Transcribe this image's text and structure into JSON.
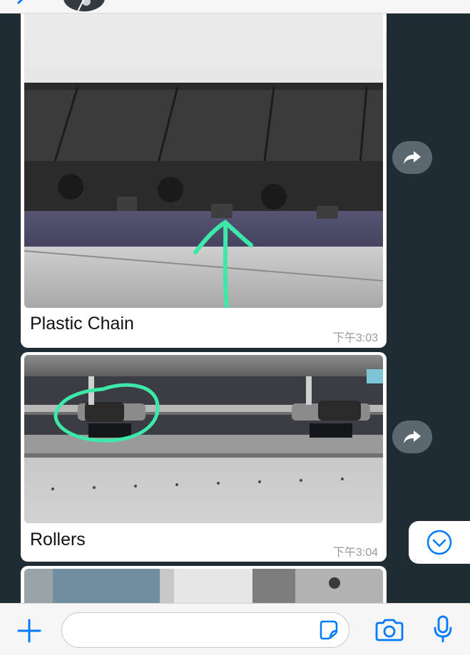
{
  "colors": {
    "chat_background": "#1f2c34",
    "bubble": "#ffffff",
    "accent_blue": "#007aff",
    "forward_button": "#5b6870",
    "annotation_green": "#3ee8a8"
  },
  "messages": [
    {
      "caption": "Plastic Chain",
      "time": "下午3:03",
      "image": "photo of black plastic cable carrier chain with green arrow annotation"
    },
    {
      "caption": "Rollers",
      "time": "下午3:04",
      "image": "photo of metal rail with rollers and green circle annotation"
    },
    {
      "caption": "",
      "time": "",
      "image": "partially visible photo of machine frame"
    }
  ],
  "icons": {
    "back": "chevron-left-icon",
    "forward": "share-forward-icon",
    "scroll_down": "chevron-down-circle-icon",
    "add": "plus-icon",
    "sticker": "sticker-icon",
    "camera": "camera-icon",
    "mic": "microphone-icon"
  },
  "composer": {
    "value": "",
    "placeholder": ""
  }
}
